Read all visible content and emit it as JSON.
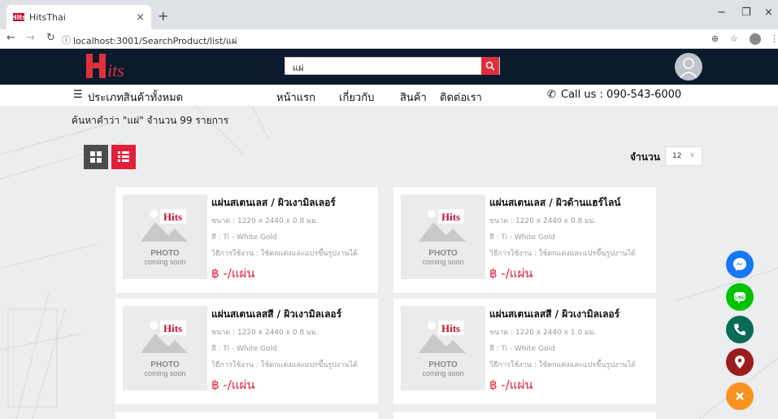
{
  "browser": {
    "tab_title": "HitsThai",
    "favicon_text": "Hits",
    "new_tab": "+",
    "url": "localhost:3001/SearchProduct/list/แผ่"
  },
  "header": {
    "logo_text": "Hits",
    "search_value": "แผ่"
  },
  "menu": {
    "categories": "ประเภทสินค้าทั้งหมด",
    "home": "หน้าแรก",
    "about": "เกี่ยวกับ",
    "products": "สินค้า",
    "contact": "ติดต่อเรา",
    "call": "Call us : 090-543-6000"
  },
  "search_result": "ค้นหาคำว่า \"แผ่\" จำนวน 99 รายการ",
  "quantity": {
    "label": "จำนวน",
    "value": "12"
  },
  "photo_placeholder": {
    "logo": "Hits",
    "line1": "PHOTO",
    "line2": "coming soon"
  },
  "products": [
    {
      "title": "แผ่นสเตนเลส / ผิวเงามิลเลอร์",
      "size": "ขนาด : 1220 x 2440 x 0.8 มม.",
      "color": "สี : Ti - White Gold",
      "usage": "วิธีการใช้งาน : ใช้ตกแต่งและแปรขึ้นรูปงานได้",
      "price": "฿ -/แผ่น"
    },
    {
      "title": "แผ่นสเตนเลส / ผิวด้านแฮร์ไลน์",
      "size": "ขนาด : 1220 x 2440 x 0.8 มม.",
      "color": "สี : Ti - White Gold",
      "usage": "วิธีการใช้งาน : ใช้ตกแต่งและแปรขึ้นรูปงานได้",
      "price": "฿ -/แผ่น"
    },
    {
      "title": "แผ่นสเตนเลสสี / ผิวเงามิลเลอร์",
      "size": "ขนาด : 1220 x 2440 x 0.8 มม.",
      "color": "สี : Ti - White Gold",
      "usage": "วิธีการใช้งาน : ใช้ตกแต่งและแปรขึ้นรูปงานได้",
      "price": "฿ -/แผ่น"
    },
    {
      "title": "แผ่นสเตนเลสสี / ผิวเงามิลเลอร์",
      "size": "ขนาด : 1220 x 2440 x 1.0 มม.",
      "color": "สี : Ti - White Gold",
      "usage": "วิธีการใช้งาน : ใช้ตกแต่งและแปรขึ้นรูปงานได้",
      "price": "฿ -/แผ่น"
    }
  ],
  "colors": {
    "header_bg": "#0b1a2d",
    "accent": "#e0203a",
    "messenger": "#1877f2",
    "line": "#00c300",
    "phone": "#0b6b57",
    "map": "#9b1c1c",
    "close": "#f7931e"
  },
  "icons": [
    "messenger-icon",
    "line-icon",
    "phone-icon",
    "map-pin-icon",
    "close-icon"
  ]
}
